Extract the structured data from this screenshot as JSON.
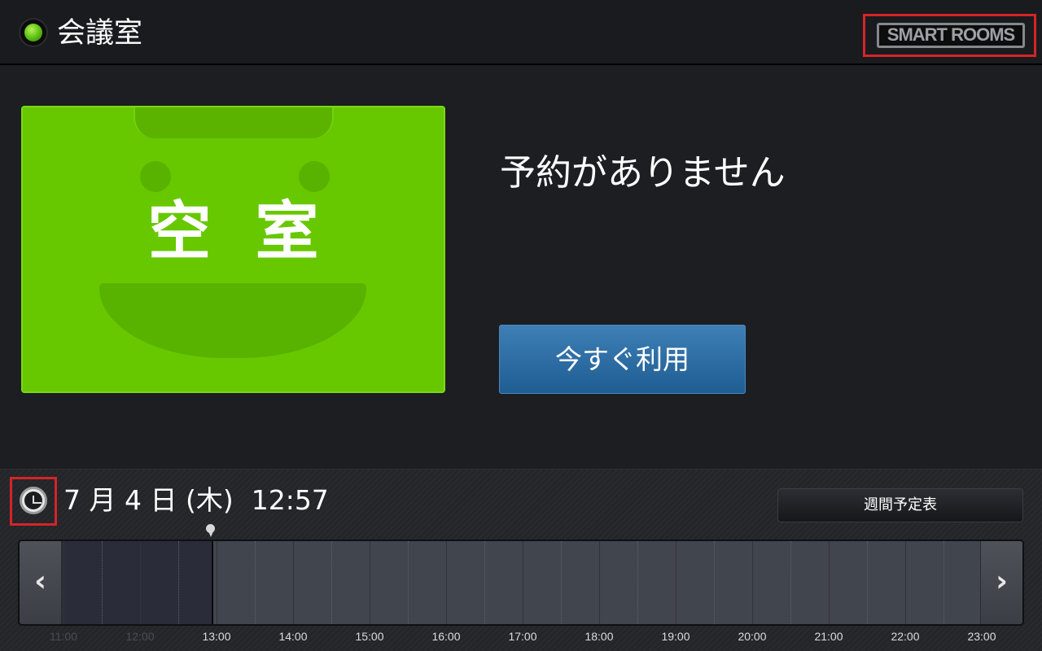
{
  "header": {
    "room_name": "会議室",
    "logo_text": "SMART ROOMS",
    "status_color": "#5fc112"
  },
  "main": {
    "status_card": {
      "label": "空室",
      "color": "#67c800"
    },
    "message": "予約がありません",
    "use_now_button": "今すぐ利用"
  },
  "footer": {
    "date": "7 月 4 日 (木)",
    "time": "12:57",
    "weekly_button": "週間予定表",
    "timeline": {
      "ticks": [
        "11:00",
        "12:00",
        "13:00",
        "14:00",
        "15:00",
        "16:00",
        "17:00",
        "18:00",
        "19:00",
        "20:00",
        "21:00",
        "22:00",
        "23:00"
      ],
      "past_ticks": [
        "11:00",
        "12:00"
      ],
      "prev_icon": "chevron-left-icon",
      "next_icon": "chevron-right-icon"
    }
  },
  "colors": {
    "accent_blue": "#2a6ca5",
    "highlight_red": "#d52427",
    "background": "#1c1e22"
  }
}
